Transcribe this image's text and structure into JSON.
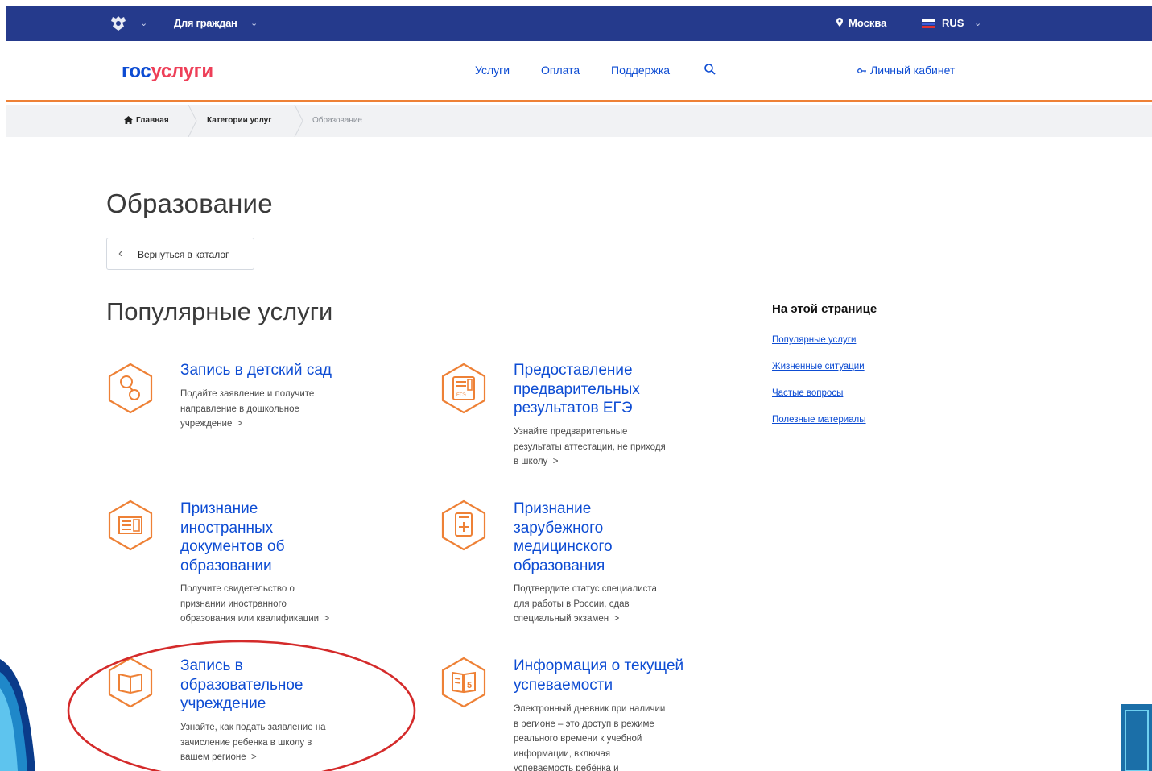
{
  "topbar": {
    "menu_label": "Для граждан",
    "city": "Москва",
    "language": "RUS",
    "icons": [
      "emblem-icon",
      "chevron-down-icon",
      "location-pin-icon",
      "flag-icon"
    ],
    "bg_color": "#253a8c"
  },
  "header": {
    "logo_part1": "гос",
    "logo_part2": "услуги",
    "nav": [
      "Услуги",
      "Оплата",
      "Поддержка"
    ],
    "cabinet_label": "Личный кабинет",
    "accent_color": "#ee8136"
  },
  "breadcrumb": [
    "Главная",
    "Категории услуг",
    "Образование"
  ],
  "page_title": "Образование",
  "back_button": "Вернуться в каталог",
  "popular_title": "Популярные услуги",
  "services": [
    {
      "icon": "baby-rattle-icon",
      "title": [
        "Запись в детский сад"
      ],
      "desc": [
        "Подайте заявление и получите",
        "направление в дошкольное",
        "учреждение"
      ]
    },
    {
      "icon": "exam-certificate-icon",
      "title": [
        "Предоставление",
        "предварительных",
        "результатов ЕГЭ"
      ],
      "desc": [
        "Узнайте предварительные",
        "результаты аттестации, не приходя",
        "в школу"
      ]
    },
    {
      "icon": "diploma-icon",
      "title": [
        "Признание",
        "иностранных",
        "документов об",
        "образовании"
      ],
      "desc": [
        "Получите свидетельство о",
        "признании иностранного",
        "образования или квалификации"
      ]
    },
    {
      "icon": "medical-document-icon",
      "title": [
        "Признание",
        "зарубежного",
        "медицинского",
        "образования"
      ],
      "desc": [
        "Подтвердите статус специалиста",
        "для работы в России, сдав",
        "специальный экзамен"
      ]
    },
    {
      "icon": "open-book-icon",
      "title": [
        "Запись в",
        "образовательное",
        "учреждение"
      ],
      "desc": [
        "Узнайте, как подать заявление на",
        "зачисление ребенка в школу в",
        "вашем регионе"
      ]
    },
    {
      "icon": "gradebook-icon",
      "title": [
        "Информация о текущей",
        "успеваемости"
      ],
      "desc": [
        "Электронный дневник при наличии",
        "в регионе – это доступ в режиме",
        "реального времени к учебной",
        "информации, включая",
        "успеваемость ребёнка и"
      ]
    }
  ],
  "aside": {
    "title": "На этой странице",
    "links": [
      "Популярные услуги",
      "Жизненные ситуации",
      "Частые вопросы",
      "Полезные материалы"
    ]
  },
  "link_arrow": ">",
  "highlight_color": "#d42a2a"
}
